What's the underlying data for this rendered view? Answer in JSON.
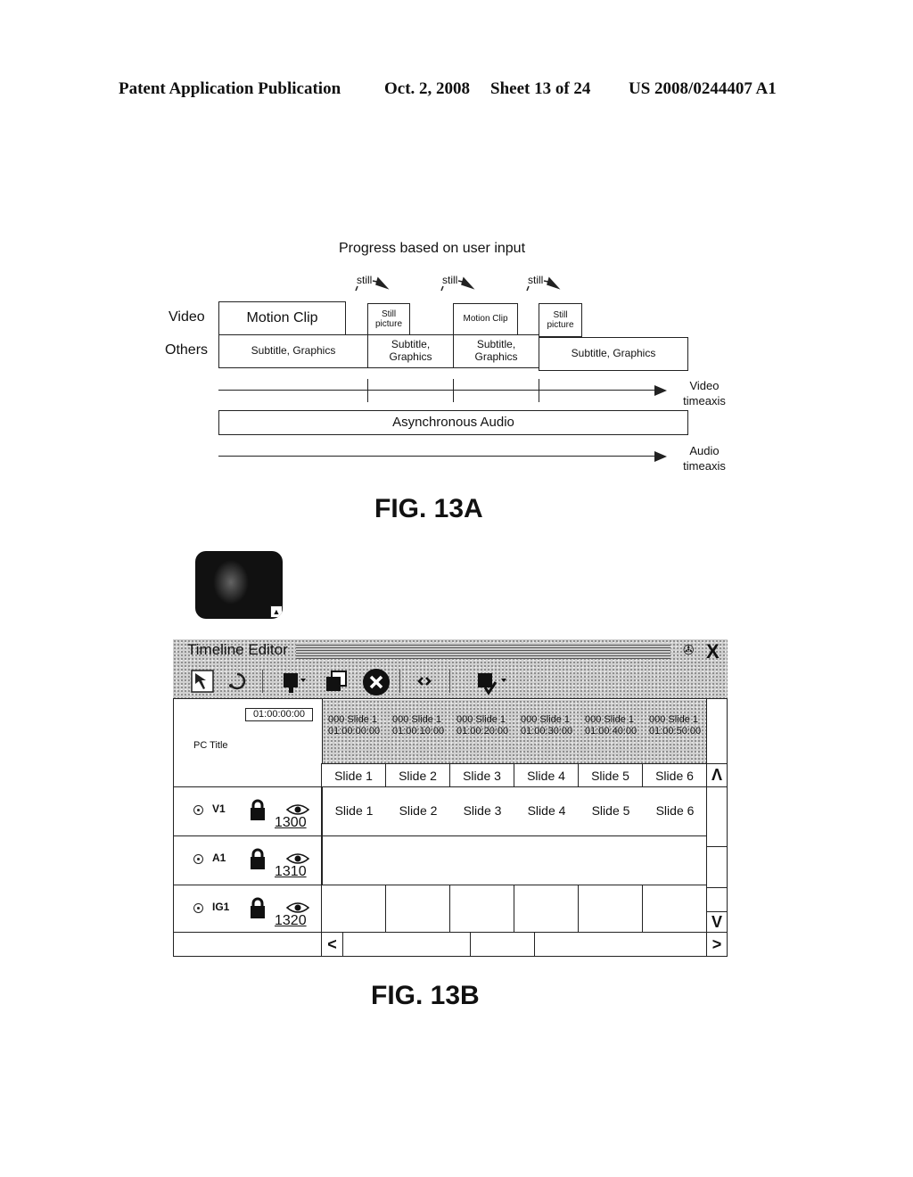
{
  "header": {
    "publication": "Patent Application Publication",
    "date": "Oct. 2, 2008",
    "sheet": "Sheet 13 of 24",
    "number": "US 2008/0244407 A1"
  },
  "fig13a": {
    "title": "Progress based on user input",
    "row_labels": {
      "video": "Video",
      "others": "Others"
    },
    "still_markers": [
      "still",
      "still",
      "still"
    ],
    "video_blocks": [
      "Motion Clip",
      "Still picture",
      "Motion Clip",
      "Still picture"
    ],
    "others_blocks": [
      "Subtitle, Graphics",
      "Subtitle, Graphics",
      "Subtitle, Graphics",
      "Subtitle, Graphics"
    ],
    "video_axis_label": "Video timeaxis",
    "audio_block": "Asynchronous Audio",
    "audio_axis_label": "Audio timeaxis",
    "caption": "FIG. 13A"
  },
  "fig13b": {
    "thumbnail_button": "▲",
    "window_title": "Timeline Editor",
    "pin_icon": "✇",
    "close_label": "X",
    "toolbar": [
      {
        "name": "select-tool-icon"
      },
      {
        "name": "undo-icon"
      },
      {
        "name": "add-clip-icon"
      },
      {
        "name": "layer-icon"
      },
      {
        "name": "delete-icon"
      },
      {
        "name": "link-icon"
      },
      {
        "name": "insert-clip-icon"
      }
    ],
    "timecode": "01:00:00:00",
    "pc_title": "PC Title",
    "ruler": [
      {
        "name": "000 Slide 1",
        "time": "01:00:00:00"
      },
      {
        "name": "000 Slide 1",
        "time": "01:00:10:00"
      },
      {
        "name": "000 Slide 1",
        "time": "01:00:20:00"
      },
      {
        "name": "000 Slide 1",
        "time": "01:00:30:00"
      },
      {
        "name": "000 Slide 1",
        "time": "01:00:40:00"
      },
      {
        "name": "000 Slide 1",
        "time": "01:00:50:00"
      }
    ],
    "slide_headers": [
      "Slide 1",
      "Slide 2",
      "Slide 3",
      "Slide 4",
      "Slide 5",
      "Slide 6"
    ],
    "tracks": [
      {
        "name": "V1",
        "ref": "1300",
        "cells": [
          "Slide 1",
          "Slide 2",
          "Slide 3",
          "Slide 4",
          "Slide 5",
          "Slide 6"
        ]
      },
      {
        "name": "A1",
        "ref": "1310",
        "cells": []
      },
      {
        "name": "IG1",
        "ref": "1320",
        "cells": [
          "",
          "",
          "",
          "",
          "",
          ""
        ]
      }
    ],
    "scroll": {
      "up": "Λ",
      "down": "V",
      "left": "<",
      "right": ">"
    },
    "caption": "FIG. 13B"
  }
}
